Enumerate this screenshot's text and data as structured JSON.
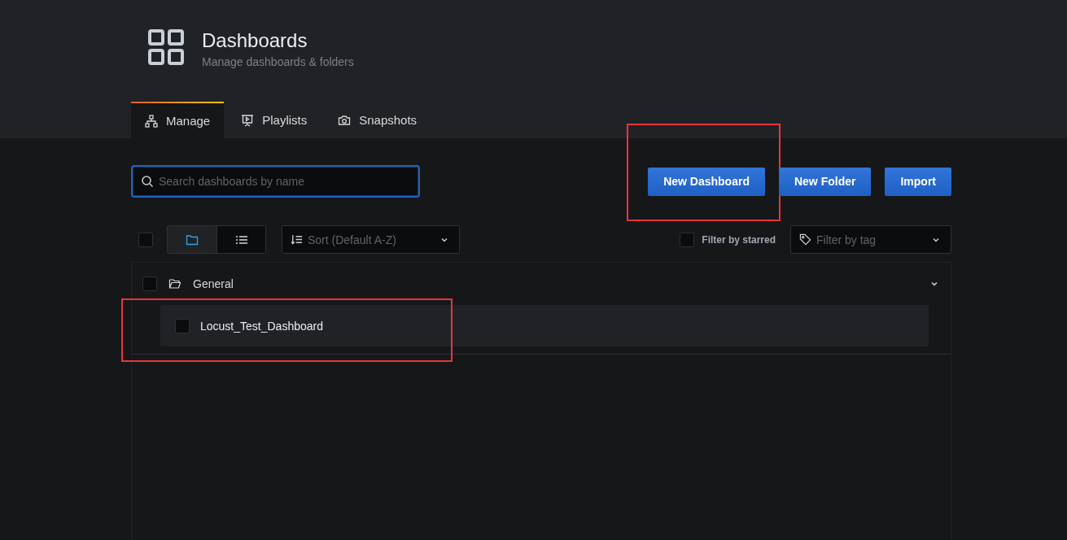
{
  "header": {
    "title": "Dashboards",
    "subtitle": "Manage dashboards & folders"
  },
  "tabs": [
    {
      "label": "Manage",
      "kind": "manage",
      "selected": true
    },
    {
      "label": "Playlists",
      "kind": "playlists",
      "selected": false
    },
    {
      "label": "Snapshots",
      "kind": "snapshots",
      "selected": false
    }
  ],
  "search": {
    "placeholder": "Search dashboards by name"
  },
  "buttons": [
    {
      "label": "New Dashboard",
      "highlighted": true
    },
    {
      "label": "New Folder",
      "highlighted": false
    },
    {
      "label": "Import",
      "highlighted": false
    }
  ],
  "select_all": {
    "checked": false
  },
  "views": [
    {
      "kind": "folder",
      "selected": true
    },
    {
      "kind": "list",
      "selected": false
    }
  ],
  "sort": {
    "placeholder": "Sort (Default A-Z)"
  },
  "starred_filter": {
    "label": "Filter by starred",
    "checked": false
  },
  "tag_filter": {
    "placeholder": "Filter by tag"
  },
  "folders": [
    {
      "name": "General",
      "checked": false,
      "expanded": true,
      "dashboards": [
        {
          "name": "Locust_Test_Dashboard",
          "checked": false,
          "highlighted": true
        }
      ]
    }
  ]
}
